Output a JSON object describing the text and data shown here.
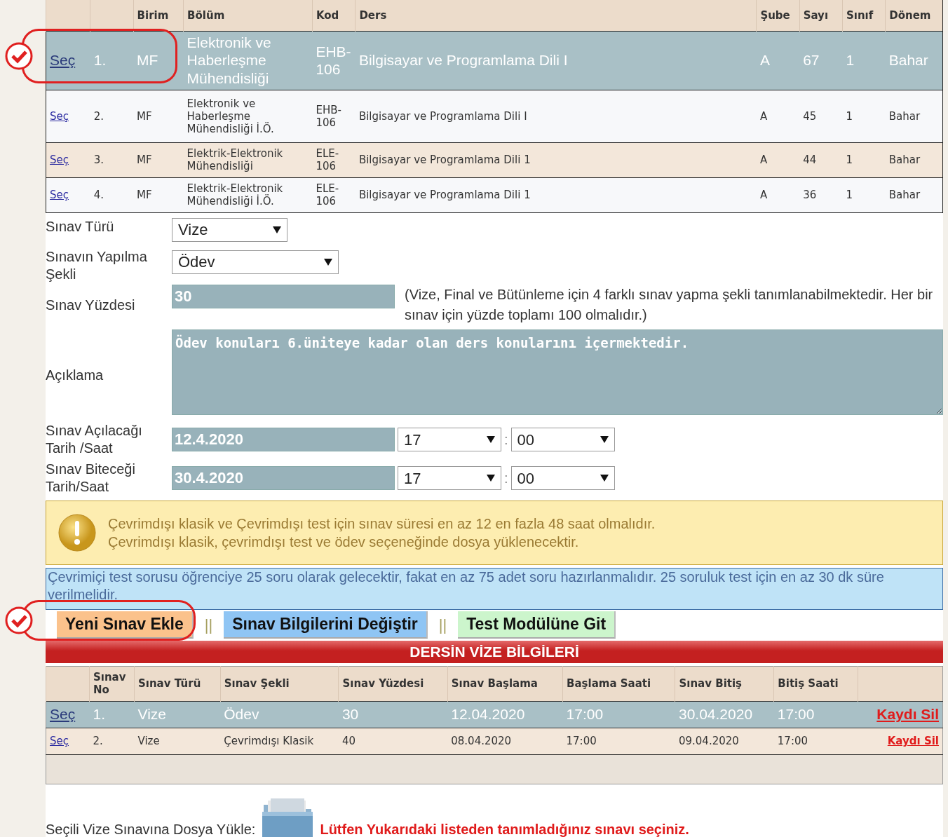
{
  "courses": {
    "columns": [
      "Birim",
      "Bölüm",
      "Kod",
      "Ders",
      "Şube",
      "Sayı",
      "Sınıf",
      "Dönem"
    ],
    "rows": [
      {
        "link": "Seç",
        "no": "1.",
        "unit": "MF",
        "department": "Elektronik ve Haberleşme Mühendisliği",
        "code": "EHB-106",
        "course": "Bilgisayar ve Programlama Dili I",
        "section": "A",
        "count": "67",
        "grade": "1",
        "term": "Bahar",
        "selected": true,
        "marked": true
      },
      {
        "link": "Seç",
        "no": "2.",
        "unit": "MF",
        "department": "Elektronik ve Haberleşme Mühendisliği İ.Ö.",
        "code": "EHB-106",
        "course": "Bilgisayar ve Programlama Dili I",
        "section": "A",
        "count": "45",
        "grade": "1",
        "term": "Bahar",
        "selected": false,
        "marked": false
      },
      {
        "link": "Seç",
        "no": "3.",
        "unit": "MF",
        "department": "Elektrik-Elektronik Mühendisliği",
        "code": "ELE-106",
        "course": "Bilgisayar ve Programlama Dili 1",
        "section": "A",
        "count": "44",
        "grade": "1",
        "term": "Bahar",
        "selected": false,
        "marked": false
      },
      {
        "link": "Seç",
        "no": "4.",
        "unit": "MF",
        "department": "Elektrik-Elektronik Mühendisliği İ.Ö.",
        "code": "ELE-106",
        "course": "Bilgisayar ve Programlama Dili 1",
        "section": "A",
        "count": "36",
        "grade": "1",
        "term": "Bahar",
        "selected": false,
        "marked": false
      }
    ]
  },
  "form": {
    "exam_type": {
      "label": "Sınav Türü",
      "value": "Vize"
    },
    "method": {
      "label": "Sınavın Yapılma Şekli",
      "value": "Ödev"
    },
    "percent": {
      "label": "Sınav Yüzdesi",
      "value": "30",
      "note": "(Vize, Final ve Bütünleme için 4 farklı sınav yapma şekli tanımlanabilmektedir. Her bir sınav için yüzde toplamı 100 olmalıdır.)"
    },
    "description": {
      "label": "Açıklama",
      "value": "Ödev konuları 6.üniteye kadar olan ders konularını içermektedir."
    },
    "times": [
      {
        "label": "Sınav Açılacağı Tarih /Saat",
        "date": "12.4.2020",
        "hour": "17",
        "separator": ":",
        "minute": "00"
      },
      {
        "label": "Sınav Biteceği Tarih/Saat",
        "date": "30.4.2020",
        "hour": "17",
        "separator": ":",
        "minute": "00"
      }
    ]
  },
  "warning": {
    "lines": [
      "Çevrimdışı klasik ve Çevrimdışı test için sınav süresi en az 12 en fazla 48 saat olmalıdır.",
      "Çevrimdışı klasik, çevrimdışı test ve ödev seçeneğinde dosya yüklenecektir."
    ]
  },
  "info": {
    "text": "Çevrimiçi test sorusu öğrenciye 25 soru olarak gelecektir, fakat en az 75 adet soru hazırlanmalıdır. 25 soruluk test için en az 30 dk süre verilmelidir."
  },
  "toolbar": [
    {
      "kind": "button",
      "label": "Yeni Sınav Ekle",
      "color": "#fbc28c",
      "marked": true
    },
    {
      "kind": "separator",
      "label": "||"
    },
    {
      "kind": "button",
      "label": "Sınav Bilgilerini Değiştir",
      "color": "#8fc5f4",
      "marked": false
    },
    {
      "kind": "separator",
      "label": "||"
    },
    {
      "kind": "button",
      "label": "Test Modülüne Git",
      "color": "#ccf5cc",
      "marked": false
    }
  ],
  "exams": {
    "title": "DERSİN VİZE BİLGİLERİ",
    "columns": [
      "Sınav No",
      "Sınav Türü",
      "Sınav Şekli",
      "Sınav Yüzdesi",
      "Sınav Başlama",
      "Başlama Saati",
      "Sınav Bitiş",
      "Bitiş Saati"
    ],
    "rows": [
      {
        "link": "Seç",
        "no": "1.",
        "type": "Vize",
        "method": "Ödev",
        "percent": "30",
        "start_date": "12.04.2020",
        "start_time": "17:00",
        "end_date": "30.04.2020",
        "end_time": "17:00",
        "delete": "Kaydı Sil",
        "selected": true
      },
      {
        "link": "Seç",
        "no": "2.",
        "type": "Vize",
        "method": "Çevrimdışı Klasik",
        "percent": "40",
        "start_date": "08.04.2020",
        "start_time": "17:00",
        "end_date": "09.04.2020",
        "end_time": "17:00",
        "delete": "Kaydı Sil",
        "selected": false
      }
    ]
  },
  "upload": {
    "label": "Seçili Vize  Sınavına Dosya Yükle:",
    "message": "Lütfen Yukarıdaki listeden tanımladığınız sınavı seçiniz."
  }
}
